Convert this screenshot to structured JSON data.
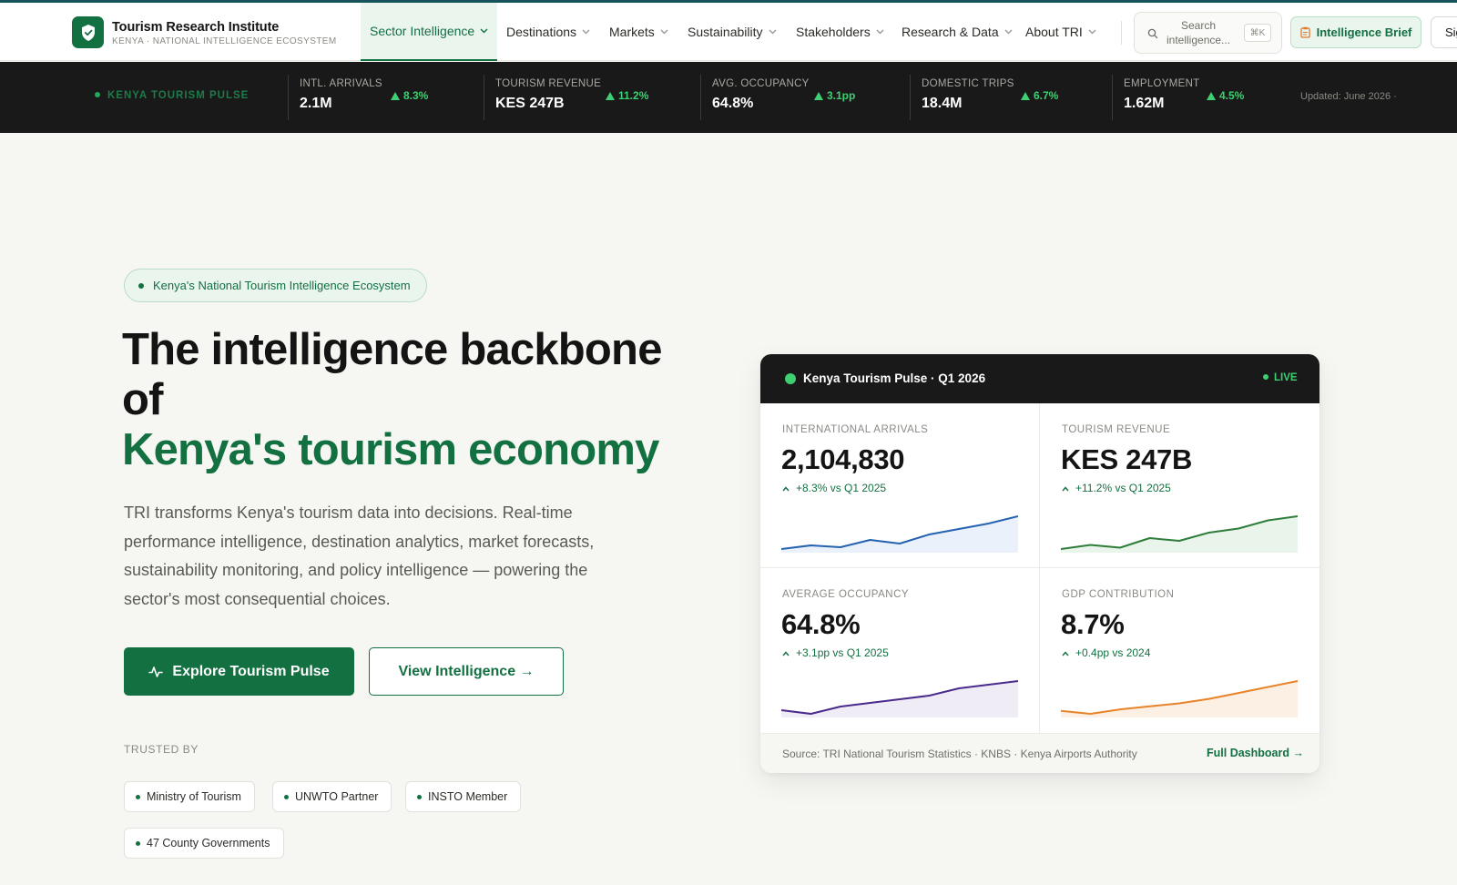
{
  "brand": {
    "name": "Tourism Research Institute",
    "tagline": "KENYA · NATIONAL INTELLIGENCE ECOSYSTEM",
    "accent_color": "#127041"
  },
  "nav": {
    "items": [
      {
        "label": "Sector Intelligence",
        "active": true
      },
      {
        "label": "Destinations"
      },
      {
        "label": "Markets"
      },
      {
        "label": "Sustainability"
      },
      {
        "label": "Stakeholders"
      },
      {
        "label": "Research & Data"
      },
      {
        "label": "About TRI"
      }
    ],
    "search": {
      "placeholder": "Search intelligence...",
      "shortcut": "⌘K"
    },
    "brief_label": "Intelligence Brief",
    "sign_in_label": "Sign in"
  },
  "ticker": {
    "label": "KENYA TOURISM PULSE",
    "items": [
      {
        "label": "INTL. ARRIVALS",
        "value": "2.1M",
        "change": "8.3%"
      },
      {
        "label": "TOURISM REVENUE",
        "value": "KES 247B",
        "change": "11.2%"
      },
      {
        "label": "AVG. OCCUPANCY",
        "value": "64.8%",
        "change": "3.1pp"
      },
      {
        "label": "DOMESTIC TRIPS",
        "value": "18.4M",
        "change": "6.7%"
      },
      {
        "label": "EMPLOYMENT",
        "value": "1.62M",
        "change": "4.5%"
      }
    ],
    "updated": "Updated: June 2026 ·",
    "up_color": "#3fcf73"
  },
  "hero": {
    "eyebrow": "Kenya's National Tourism Intelligence Ecosystem",
    "title_line1": "The intelligence backbone of",
    "title_line2": "Kenya's tourism economy",
    "lede": "TRI transforms Kenya's tourism data into decisions. Real-time performance intelligence, destination analytics, market forecasts, sustainability monitoring, and policy intelligence — powering the sector's most consequential choices.",
    "primary_cta": "Explore Tourism Pulse",
    "secondary_cta": "View Intelligence →",
    "trusted_label": "TRUSTED BY",
    "trusted": [
      "Ministry of Tourism",
      "UNWTO Partner",
      "INSTO Member",
      "47 County Governments"
    ]
  },
  "pulse_card": {
    "title": "Kenya Tourism Pulse · Q1 2026",
    "live_label": "LIVE",
    "metrics": [
      {
        "label": "INTERNATIONAL ARRIVALS",
        "value": "2,104,830",
        "change": "+8.3% vs Q1 2025",
        "color": "#2563b0",
        "fill": "#eaf1fa",
        "trend": [
          2,
          4,
          3,
          7,
          5,
          10,
          13,
          16,
          20
        ]
      },
      {
        "label": "TOURISM REVENUE",
        "value": "KES 247B",
        "change": "+11.2% vs Q1 2025",
        "color": "#2e7d3a",
        "fill": "#e9f4ea",
        "trend": [
          1,
          4,
          2,
          9,
          7,
          13,
          16,
          22,
          25
        ]
      },
      {
        "label": "AVERAGE OCCUPANCY",
        "value": "64.8%",
        "change": "+3.1pp vs Q1 2025",
        "color": "#4a2a8a",
        "fill": "#efecf6",
        "trend": [
          4,
          2,
          6,
          8,
          10,
          12,
          16,
          18,
          20
        ]
      },
      {
        "label": "GDP CONTRIBUTION",
        "value": "8.7%",
        "change": "+0.4pp vs 2024",
        "color": "#e8832a",
        "fill": "#fcefe3",
        "trend": [
          3,
          1,
          4,
          6,
          8,
          11,
          15,
          19,
          23
        ]
      }
    ],
    "source": "Source: TRI National Tourism Statistics · KNBS · Kenya Airports Authority",
    "full_dashboard": "Full Dashboard →"
  }
}
